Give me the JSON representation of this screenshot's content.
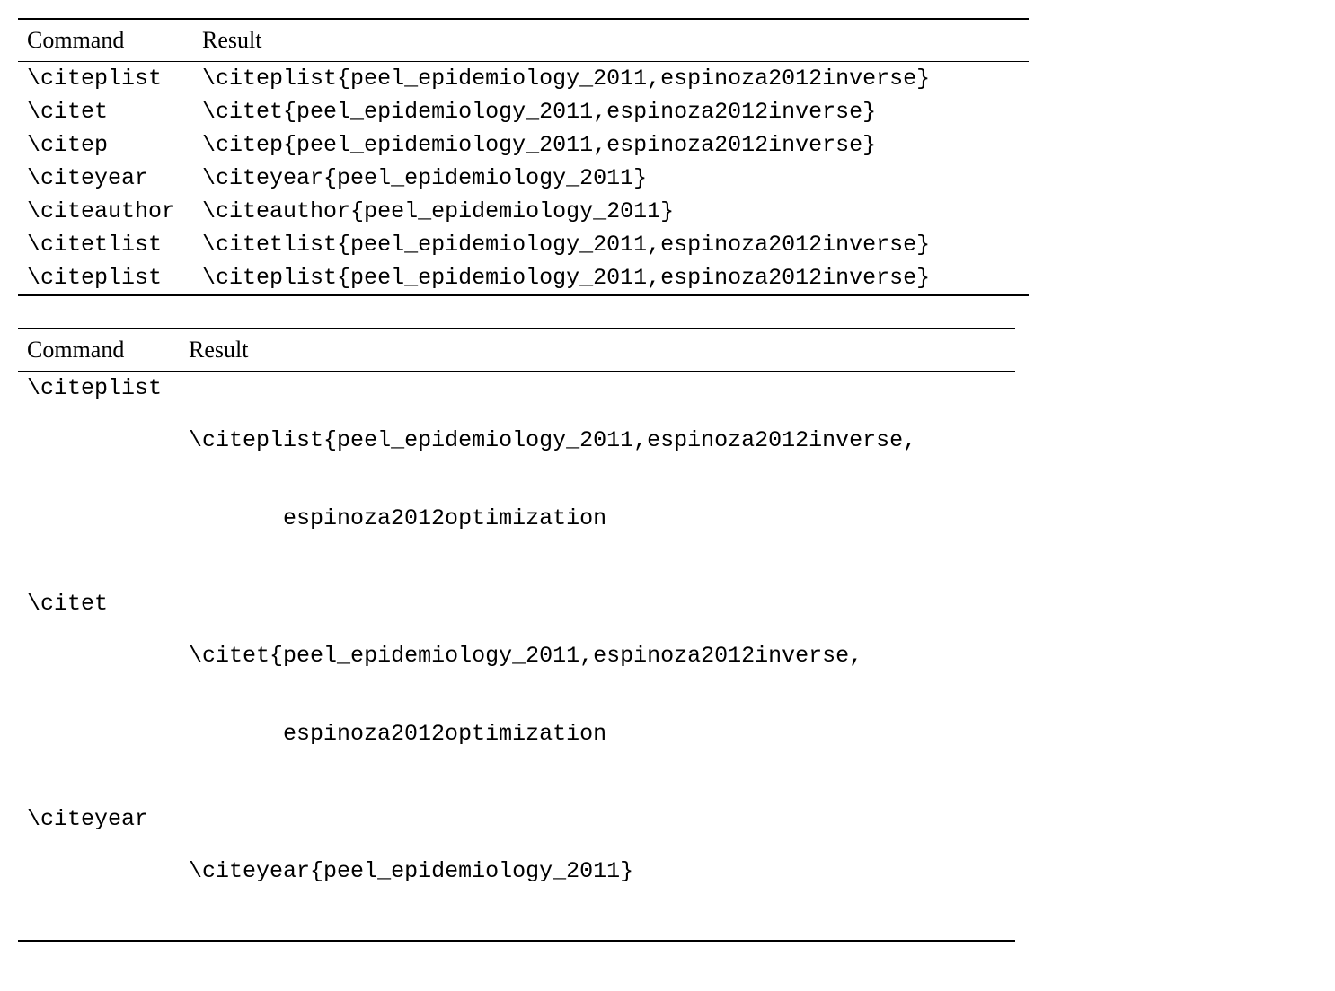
{
  "table1": {
    "headers": {
      "col1": "Command",
      "col2": "Result"
    },
    "rows": [
      {
        "command": "\\citeplist",
        "result": "\\citeplist{peel_epidemiology_2011,espinoza2012inverse}"
      },
      {
        "command": "\\citet",
        "result": "\\citet{peel_epidemiology_2011,espinoza2012inverse}"
      },
      {
        "command": "\\citep",
        "result": "\\citep{peel_epidemiology_2011,espinoza2012inverse}"
      },
      {
        "command": "\\citeyear",
        "result": "\\citeyear{peel_epidemiology_2011}"
      },
      {
        "command": "\\citeauthor",
        "result": "\\citeauthor{peel_epidemiology_2011}"
      },
      {
        "command": "\\citetlist",
        "result": "\\citetlist{peel_epidemiology_2011,espinoza2012inverse}"
      },
      {
        "command": "\\citeplist",
        "result": "\\citeplist{peel_epidemiology_2011,espinoza2012inverse}"
      }
    ]
  },
  "table2": {
    "headers": {
      "col1": "Command",
      "col2": "Result"
    },
    "rows": [
      {
        "command": "\\citeplist",
        "result_lines": [
          "\\citeplist{peel_epidemiology_2011,espinoza2012inverse,",
          "espinoza2012optimization"
        ]
      },
      {
        "command": "\\citet",
        "result_lines": [
          "\\citet{peel_epidemiology_2011,espinoza2012inverse,",
          "espinoza2012optimization"
        ]
      },
      {
        "command": "\\citeyear",
        "result_lines": [
          "\\citeyear{peel_epidemiology_2011}"
        ]
      }
    ]
  }
}
